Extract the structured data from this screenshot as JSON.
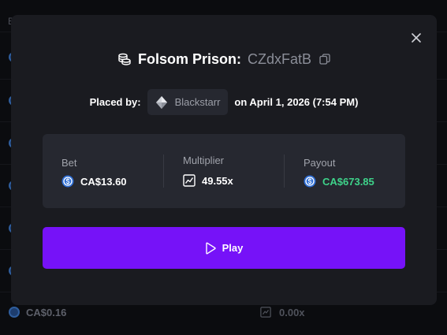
{
  "background": {
    "header_text": "B",
    "bottom_row": {
      "amount": "CA$0.16",
      "multiplier": "0.00x"
    }
  },
  "modal": {
    "game_name": "Folsom Prison:",
    "bet_id": "CZdxFatB",
    "placed_by_label": "Placed by:",
    "username": "Blackstarr",
    "placed_date": "on April 1, 2026 (7:54 PM)",
    "stats": {
      "bet_label": "Bet",
      "bet_value": "CA$13.60",
      "multiplier_label": "Multiplier",
      "multiplier_value": "49.55x",
      "payout_label": "Payout",
      "payout_value": "CA$673.85"
    },
    "play_label": "Play"
  },
  "colors": {
    "accent": "#7612f8",
    "payout_green": "#3ed38a",
    "modal_bg": "#1a1b20",
    "card_bg": "#262830"
  },
  "icons": [
    "close-icon",
    "coins-icon",
    "copy-icon",
    "diamond-icon",
    "coin-icon",
    "multiplier-chart-icon",
    "play-icon"
  ]
}
